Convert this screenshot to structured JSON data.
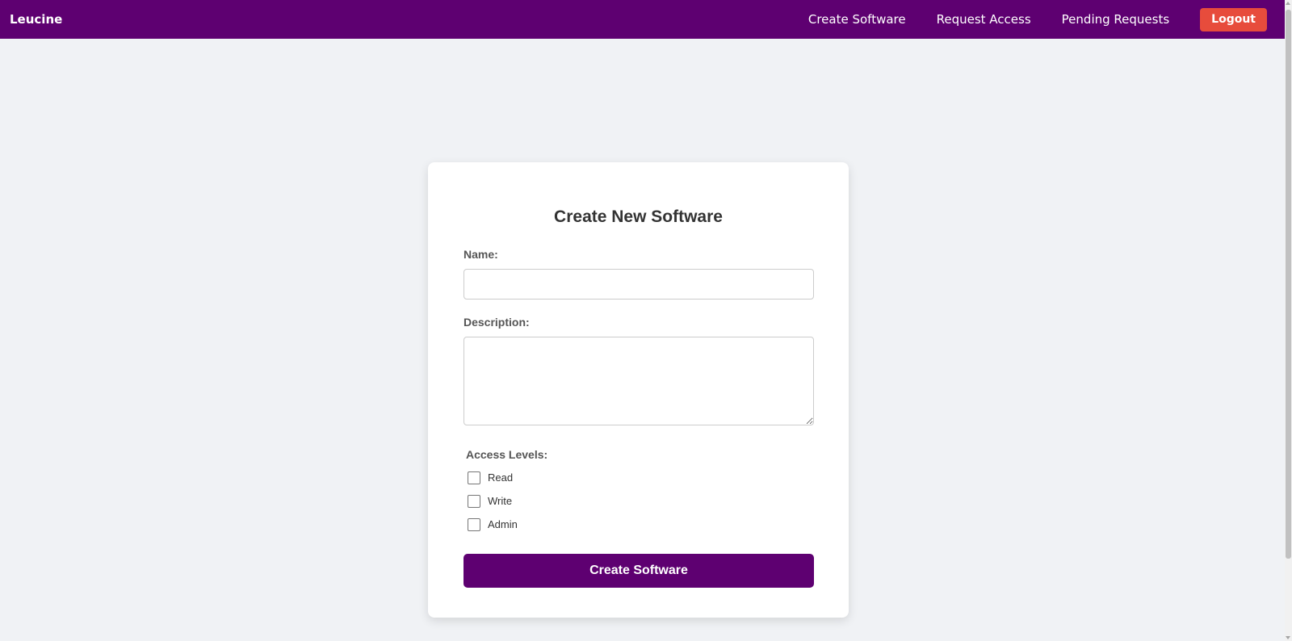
{
  "navbar": {
    "brand": "Leucine",
    "links": [
      "Create Software",
      "Request Access",
      "Pending Requests"
    ],
    "logout_label": "Logout",
    "colors": {
      "background": "#5e0071",
      "logout": "#e74c3c"
    }
  },
  "form": {
    "title": "Create New Software",
    "name_label": "Name:",
    "name_value": "",
    "description_label": "Description:",
    "description_value": "",
    "access_label": "Access Levels:",
    "access_options": [
      {
        "label": "Read",
        "checked": false
      },
      {
        "label": "Write",
        "checked": false
      },
      {
        "label": "Admin",
        "checked": false
      }
    ],
    "submit_label": "Create Software"
  }
}
